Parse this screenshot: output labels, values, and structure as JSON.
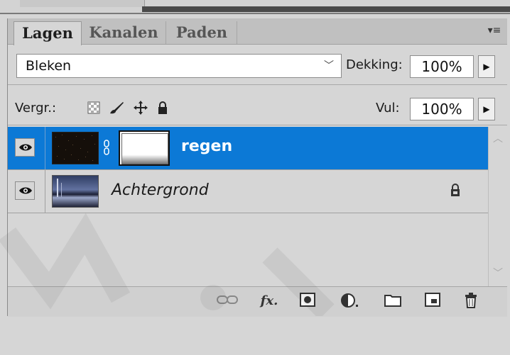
{
  "tabs": [
    "Lagen",
    "Kanalen",
    "Paden"
  ],
  "blend_mode": "Bleken",
  "opacity_label": "Dekking:",
  "opacity_value": "100%",
  "lock_label": "Vergr.:",
  "fill_label": "Vul:",
  "fill_value": "100%",
  "layers": [
    {
      "name": "regen",
      "selected": true,
      "visible": true,
      "has_mask": true
    },
    {
      "name": "Achtergrond",
      "selected": false,
      "visible": true,
      "locked": true
    }
  ],
  "colors": {
    "selected_row": "#0c79d6",
    "panel_bg": "#d6d6d6"
  },
  "icons": {
    "panel_menu": "panel-menu-icon",
    "lock_transparent": "lock-transparent-pixels-icon",
    "lock_image": "lock-image-pixels-icon",
    "lock_position": "lock-position-icon",
    "lock_all": "lock-all-icon",
    "bottom": [
      "link-layers-icon",
      "fx-icon",
      "add-mask-icon",
      "adjustment-layer-icon",
      "group-folder-icon",
      "new-layer-icon",
      "delete-icon"
    ]
  }
}
